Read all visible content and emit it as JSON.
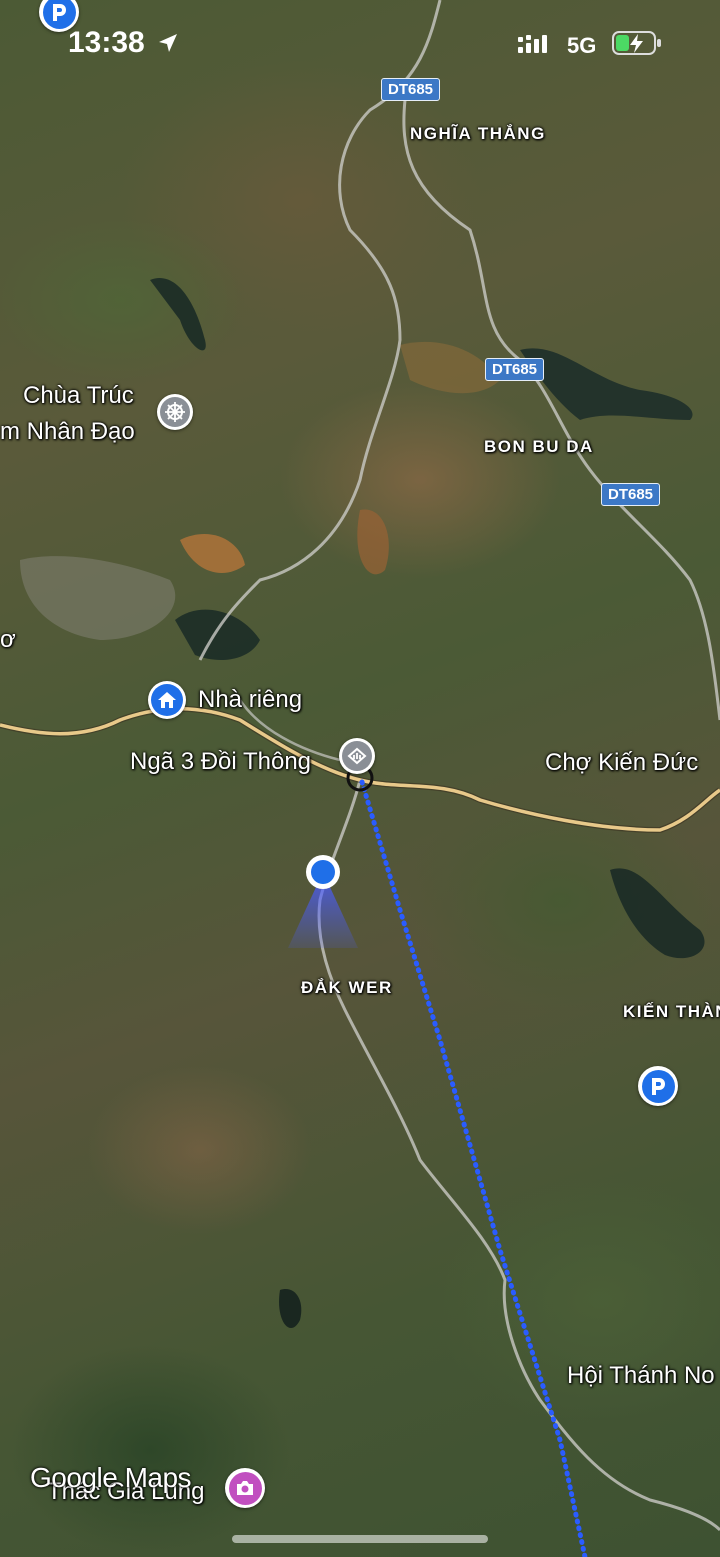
{
  "status_bar": {
    "time": "13:38",
    "network": "5G"
  },
  "road_badges": [
    "DT685",
    "DT685",
    "DT685"
  ],
  "labels": {
    "nghia_thang": "NGHĨA THẮNG",
    "chua_truc": "Chùa Trúc",
    "chua_truc_line2": "m Nhân Đạo",
    "bon_bu_da": "BON BU DA",
    "nha_rieng": "Nhà riêng",
    "nga3": "Ngã 3 Đồi Thông",
    "cho_kien_duc": "Chợ Kiến Đức",
    "dak_wer": "ĐẮK WER",
    "kien_thanh": "KIẾN THÀN",
    "hoi_thanh": "Hội Thánh No",
    "thac_gia_lung": "Thác Gia Lung",
    "left_edge": "ơ"
  },
  "watermark": "Google Maps",
  "colors": {
    "accent_blue": "#1f6fe8",
    "road_badge": "#3c78c6",
    "main_road": "#e8c98a",
    "route_dots": "#2a5cff",
    "photo_pin": "#c14fc0"
  },
  "icons": {
    "parking_top": "parking-icon",
    "location_arrow": "location-arrow-icon",
    "signal": "signal-icon",
    "battery": "battery-charging-icon",
    "temple": "dharma-wheel-icon",
    "home": "home-icon",
    "junction": "junction-icon",
    "parking_right": "parking-icon",
    "photo": "camera-icon",
    "user_location": "user-location-dot"
  }
}
